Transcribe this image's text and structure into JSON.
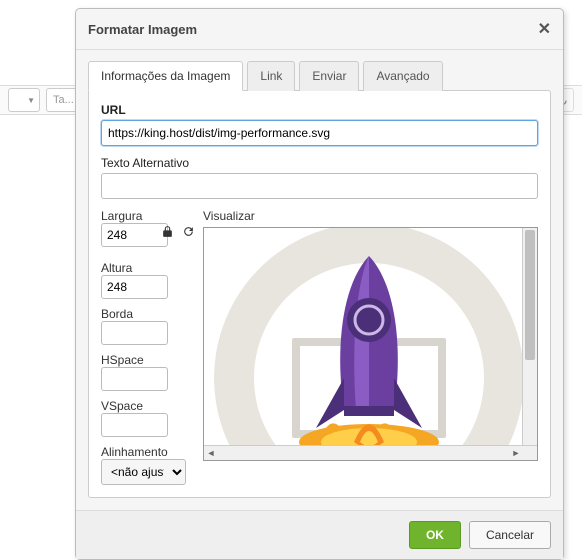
{
  "dialog": {
    "title": "Formatar Imagem",
    "tabs": {
      "info": "Informações da Imagem",
      "link": "Link",
      "upload": "Enviar",
      "advanced": "Avançado"
    },
    "url_label": "URL",
    "url_value": "https://king.host/dist/img-performance.svg",
    "alt_label": "Texto Alternativo",
    "alt_value": "",
    "width_label": "Largura",
    "width_value": "248",
    "height_label": "Altura",
    "height_value": "248",
    "border_label": "Borda",
    "border_value": "",
    "hspace_label": "HSpace",
    "hspace_value": "",
    "vspace_label": "VSpace",
    "vspace_value": "",
    "align_label": "Alinhamento",
    "align_value": "<não ajust",
    "preview_label": "Visualizar",
    "ok": "OK",
    "cancel": "Cancelar"
  },
  "bg": {
    "ta_placeholder": "Ta..."
  }
}
